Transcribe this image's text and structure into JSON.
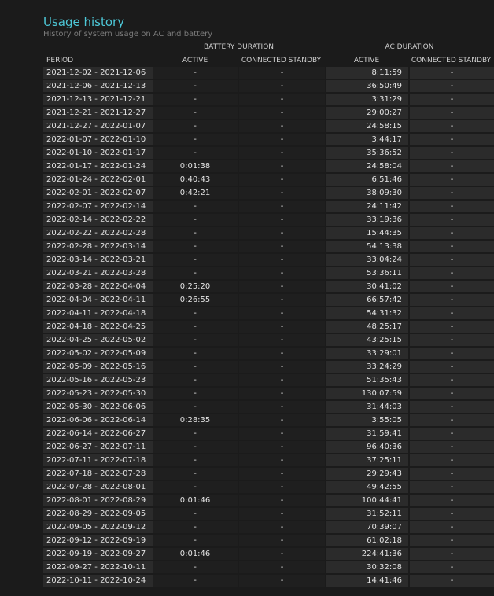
{
  "header": {
    "title": "Usage history",
    "subtitle": "History of system usage on AC and battery"
  },
  "table": {
    "groups": {
      "battery": "BATTERY DURATION",
      "ac": "AC DURATION"
    },
    "columns": {
      "period": "PERIOD",
      "battery_active": "ACTIVE",
      "battery_standby": "CONNECTED STANDBY",
      "ac_active": "ACTIVE",
      "ac_standby": "CONNECTED STANDBY"
    },
    "rows": [
      [
        "2021-12-02 - 2021-12-06",
        "-",
        "-",
        "8:11:59",
        "-"
      ],
      [
        "2021-12-06 - 2021-12-13",
        "-",
        "-",
        "36:50:49",
        "-"
      ],
      [
        "2021-12-13 - 2021-12-21",
        "-",
        "-",
        "3:31:29",
        "-"
      ],
      [
        "2021-12-21 - 2021-12-27",
        "-",
        "-",
        "29:00:27",
        "-"
      ],
      [
        "2021-12-27 - 2022-01-07",
        "-",
        "-",
        "24:58:15",
        "-"
      ],
      [
        "2022-01-07 - 2022-01-10",
        "-",
        "-",
        "3:44:17",
        "-"
      ],
      [
        "2022-01-10 - 2022-01-17",
        "-",
        "-",
        "35:36:52",
        "-"
      ],
      [
        "2022-01-17 - 2022-01-24",
        "0:01:38",
        "-",
        "24:58:04",
        "-"
      ],
      [
        "2022-01-24 - 2022-02-01",
        "0:40:43",
        "-",
        "6:51:46",
        "-"
      ],
      [
        "2022-02-01 - 2022-02-07",
        "0:42:21",
        "-",
        "38:09:30",
        "-"
      ],
      [
        "2022-02-07 - 2022-02-14",
        "-",
        "-",
        "24:11:42",
        "-"
      ],
      [
        "2022-02-14 - 2022-02-22",
        "-",
        "-",
        "33:19:36",
        "-"
      ],
      [
        "2022-02-22 - 2022-02-28",
        "-",
        "-",
        "15:44:35",
        "-"
      ],
      [
        "2022-02-28 - 2022-03-14",
        "-",
        "-",
        "54:13:38",
        "-"
      ],
      [
        "2022-03-14 - 2022-03-21",
        "-",
        "-",
        "33:04:24",
        "-"
      ],
      [
        "2022-03-21 - 2022-03-28",
        "-",
        "-",
        "53:36:11",
        "-"
      ],
      [
        "2022-03-28 - 2022-04-04",
        "0:25:20",
        "-",
        "30:41:02",
        "-"
      ],
      [
        "2022-04-04 - 2022-04-11",
        "0:26:55",
        "-",
        "66:57:42",
        "-"
      ],
      [
        "2022-04-11 - 2022-04-18",
        "-",
        "-",
        "54:31:32",
        "-"
      ],
      [
        "2022-04-18 - 2022-04-25",
        "-",
        "-",
        "48:25:17",
        "-"
      ],
      [
        "2022-04-25 - 2022-05-02",
        "-",
        "-",
        "43:25:15",
        "-"
      ],
      [
        "2022-05-02 - 2022-05-09",
        "-",
        "-",
        "33:29:01",
        "-"
      ],
      [
        "2022-05-09 - 2022-05-16",
        "-",
        "-",
        "33:24:29",
        "-"
      ],
      [
        "2022-05-16 - 2022-05-23",
        "-",
        "-",
        "51:35:43",
        "-"
      ],
      [
        "2022-05-23 - 2022-05-30",
        "-",
        "-",
        "130:07:59",
        "-"
      ],
      [
        "2022-05-30 - 2022-06-06",
        "-",
        "-",
        "31:44:03",
        "-"
      ],
      [
        "2022-06-06 - 2022-06-14",
        "0:28:35",
        "-",
        "3:55:05",
        "-"
      ],
      [
        "2022-06-14 - 2022-06-27",
        "-",
        "-",
        "31:59:41",
        "-"
      ],
      [
        "2022-06-27 - 2022-07-11",
        "-",
        "-",
        "96:40:36",
        "-"
      ],
      [
        "2022-07-11 - 2022-07-18",
        "-",
        "-",
        "37:25:11",
        "-"
      ],
      [
        "2022-07-18 - 2022-07-28",
        "-",
        "-",
        "29:29:43",
        "-"
      ],
      [
        "2022-07-28 - 2022-08-01",
        "-",
        "-",
        "49:42:55",
        "-"
      ],
      [
        "2022-08-01 - 2022-08-29",
        "0:01:46",
        "-",
        "100:44:41",
        "-"
      ],
      [
        "2022-08-29 - 2022-09-05",
        "-",
        "-",
        "31:52:11",
        "-"
      ],
      [
        "2022-09-05 - 2022-09-12",
        "-",
        "-",
        "70:39:07",
        "-"
      ],
      [
        "2022-09-12 - 2022-09-19",
        "-",
        "-",
        "61:02:18",
        "-"
      ],
      [
        "2022-09-19 - 2022-09-27",
        "0:01:46",
        "-",
        "224:41:36",
        "-"
      ],
      [
        "2022-09-27 - 2022-10-11",
        "-",
        "-",
        "30:32:08",
        "-"
      ],
      [
        "2022-10-11 - 2022-10-24",
        "-",
        "-",
        "14:41:46",
        "-"
      ]
    ]
  }
}
